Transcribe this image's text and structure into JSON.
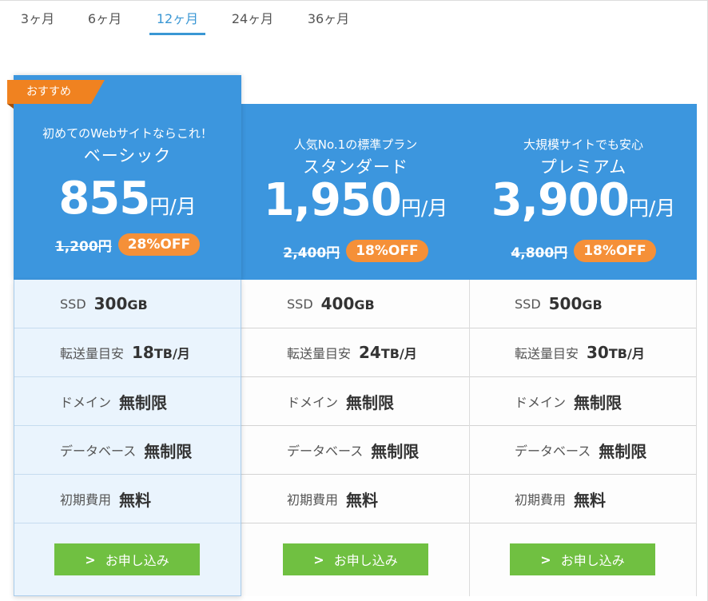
{
  "tabs": [
    {
      "label": "3ヶ月"
    },
    {
      "label": "6ヶ月"
    },
    {
      "label": "12ヶ月"
    },
    {
      "label": "24ヶ月"
    },
    {
      "label": "36ヶ月"
    }
  ],
  "active_tab": "12ヶ月",
  "recommend_label": "おすすめ",
  "plans": [
    {
      "tagline": "初めてのWebサイトならこれ！",
      "name": "ベーシック",
      "price": "855",
      "price_unit": "円/月",
      "old_price": "1,200円",
      "discount": "28%OFF",
      "ssd_label": "SSD",
      "ssd_value": "300",
      "ssd_unit": "GB",
      "transfer_label": "転送量目安",
      "transfer_value": "18",
      "transfer_unit": "TB/月",
      "domain_label": "ドメイン",
      "domain_value": "無制限",
      "db_label": "データベース",
      "db_value": "無制限",
      "setup_label": "初期費用",
      "setup_value": "無料",
      "apply_label": "お申し込み"
    },
    {
      "tagline": "人気No.1の標準プラン",
      "name": "スタンダード",
      "price": "1,950",
      "price_unit": "円/月",
      "old_price": "2,400円",
      "discount": "18%OFF",
      "ssd_label": "SSD",
      "ssd_value": "400",
      "ssd_unit": "GB",
      "transfer_label": "転送量目安",
      "transfer_value": "24",
      "transfer_unit": "TB/月",
      "domain_label": "ドメイン",
      "domain_value": "無制限",
      "db_label": "データベース",
      "db_value": "無制限",
      "setup_label": "初期費用",
      "setup_value": "無料",
      "apply_label": "お申し込み"
    },
    {
      "tagline": "大規模サイトでも安心",
      "name": "プレミアム",
      "price": "3,900",
      "price_unit": "円/月",
      "old_price": "4,800円",
      "discount": "18%OFF",
      "ssd_label": "SSD",
      "ssd_value": "500",
      "ssd_unit": "GB",
      "transfer_label": "転送量目安",
      "transfer_value": "30",
      "transfer_unit": "TB/月",
      "domain_label": "ドメイン",
      "domain_value": "無制限",
      "db_label": "データベース",
      "db_value": "無制限",
      "setup_label": "初期費用",
      "setup_value": "無料",
      "apply_label": "お申し込み"
    }
  ],
  "colors": {
    "header_blue": "#3c96de",
    "tab_active": "#3a97d4",
    "discount_orange": "#f59038",
    "recommend_orange": "#f08220",
    "apply_green": "#70c041"
  },
  "icons": {
    "apply_chevron": "chevron-right-icon"
  }
}
